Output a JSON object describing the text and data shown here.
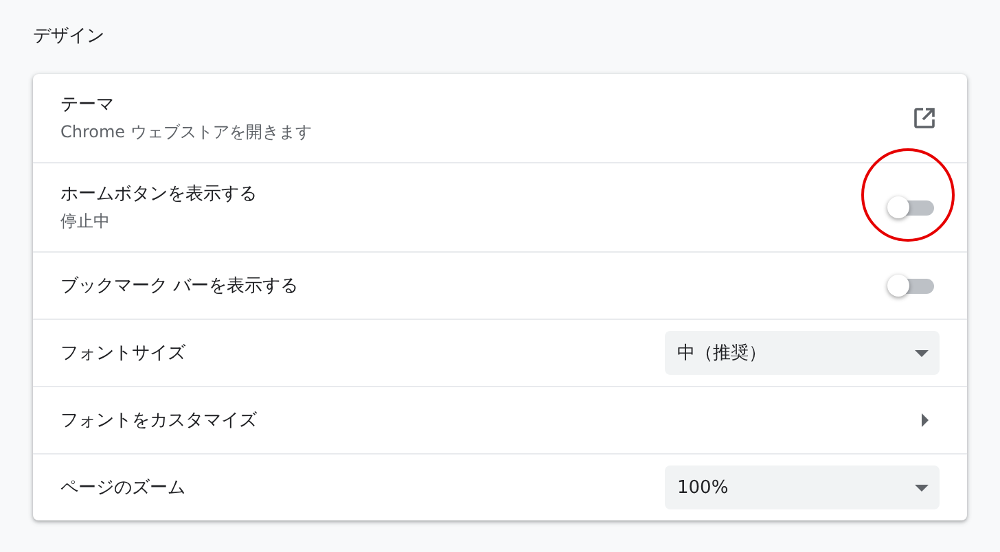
{
  "section_title": "デザイン",
  "rows": [
    {
      "kind": "link",
      "label": "テーマ",
      "sublabel": "Chrome ウェブストアを開きます"
    },
    {
      "kind": "toggle",
      "label": "ホームボタンを表示する",
      "sublabel": "停止中",
      "on": false,
      "highlighted": true
    },
    {
      "kind": "toggle",
      "label": "ブックマーク バーを表示する",
      "on": false,
      "highlighted": false
    },
    {
      "kind": "select",
      "label": "フォントサイズ",
      "value": "中（推奨）"
    },
    {
      "kind": "submenu",
      "label": "フォントをカスタマイズ"
    },
    {
      "kind": "select",
      "label": "ページのズーム",
      "value": "100%"
    }
  ]
}
